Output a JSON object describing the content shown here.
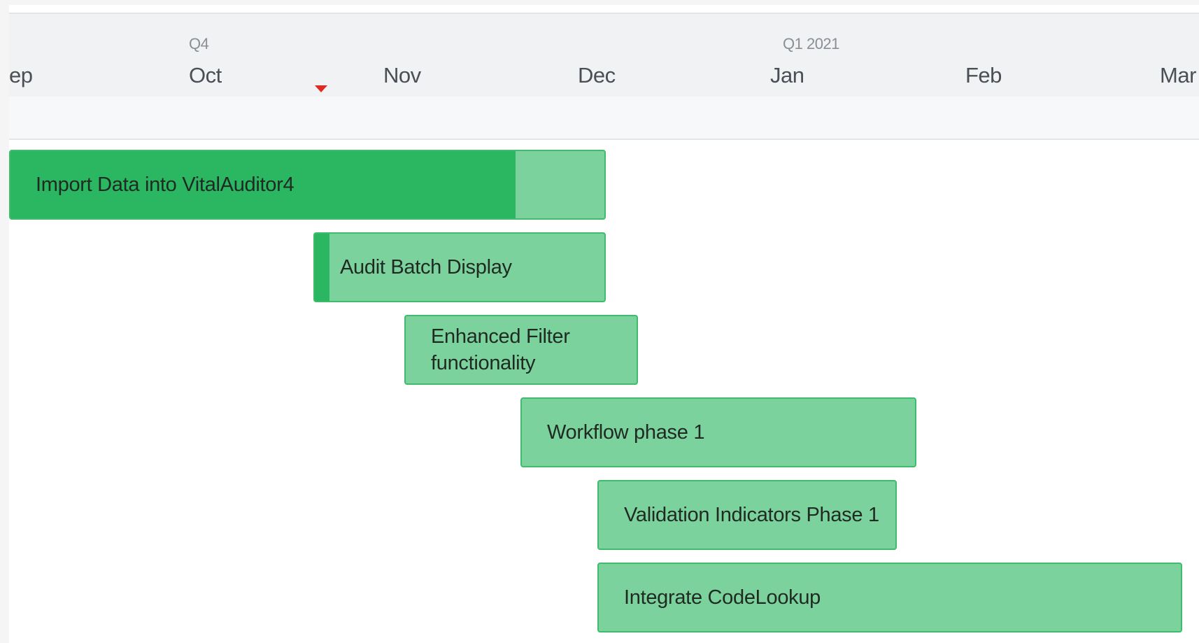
{
  "timeline": {
    "quarters": [
      "Q4",
      "Q1 2021"
    ],
    "months": [
      "ep",
      "Oct",
      "Nov",
      "Dec",
      "Jan",
      "Feb",
      "Mar"
    ]
  },
  "tasks": [
    {
      "label": "Import Data into VitalAuditor4",
      "progress": 0.85
    },
    {
      "label": "Audit Batch Display",
      "progress": 0.05
    },
    {
      "label": "Enhanced Filter functionality",
      "progress": 0
    },
    {
      "label": "Workflow phase 1",
      "progress": 0
    },
    {
      "label": "Validation Indicators Phase 1",
      "progress": 0
    },
    {
      "label": "Integrate CodeLookup",
      "progress": 0
    }
  ],
  "colors": {
    "bar_fill": "#7cd29c",
    "bar_progress": "#2bb762",
    "bar_border": "#3fbb6c",
    "today_marker": "#e02a20"
  }
}
